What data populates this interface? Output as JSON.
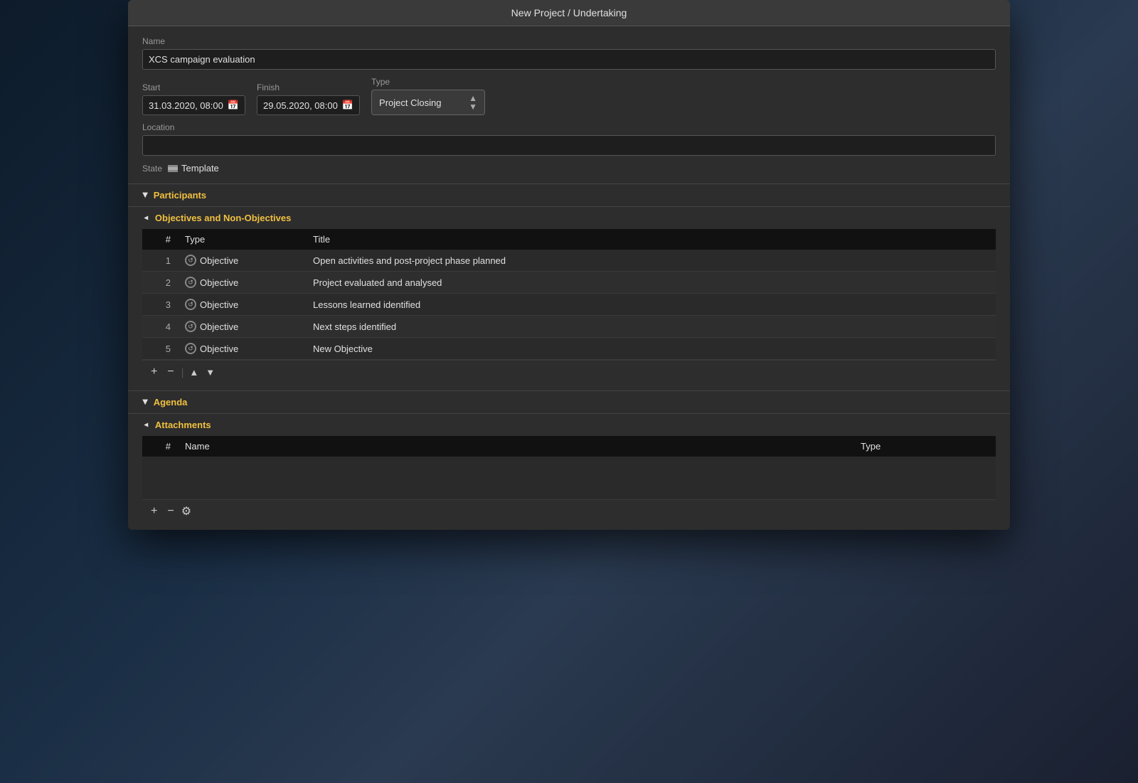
{
  "window": {
    "title": "New Project / Undertaking"
  },
  "form": {
    "name_label": "Name",
    "name_value": "XCS campaign evaluation",
    "start_label": "Start",
    "start_value": "31.03.2020, 08:00",
    "finish_label": "Finish",
    "finish_value": "29.05.2020, 08:00",
    "type_label": "Type",
    "type_value": "Project Closing",
    "location_label": "Location",
    "location_value": "",
    "state_label": "State",
    "state_template": "Template"
  },
  "sections": {
    "participants": {
      "label": "Participants",
      "collapsed": true
    },
    "objectives": {
      "label": "Objectives and Non-Objectives",
      "collapsed": false,
      "table": {
        "col_num": "#",
        "col_type": "Type",
        "col_title": "Title",
        "rows": [
          {
            "num": "1",
            "type": "Objective",
            "title": "Open activities and post-project phase planned"
          },
          {
            "num": "2",
            "type": "Objective",
            "title": "Project evaluated and analysed"
          },
          {
            "num": "3",
            "type": "Objective",
            "title": "Lessons learned identified"
          },
          {
            "num": "4",
            "type": "Objective",
            "title": "Next steps identified"
          },
          {
            "num": "5",
            "type": "Objective",
            "title": "New Objective"
          }
        ]
      },
      "toolbar": {
        "add": "+",
        "remove": "−",
        "divider": "|",
        "up": "▲",
        "down": "▼"
      }
    },
    "agenda": {
      "label": "Agenda",
      "collapsed": true
    },
    "attachments": {
      "label": "Attachments",
      "collapsed": false,
      "table": {
        "col_num": "#",
        "col_name": "Name",
        "col_type": "Type"
      },
      "toolbar": {
        "add": "+",
        "remove": "−"
      }
    }
  }
}
